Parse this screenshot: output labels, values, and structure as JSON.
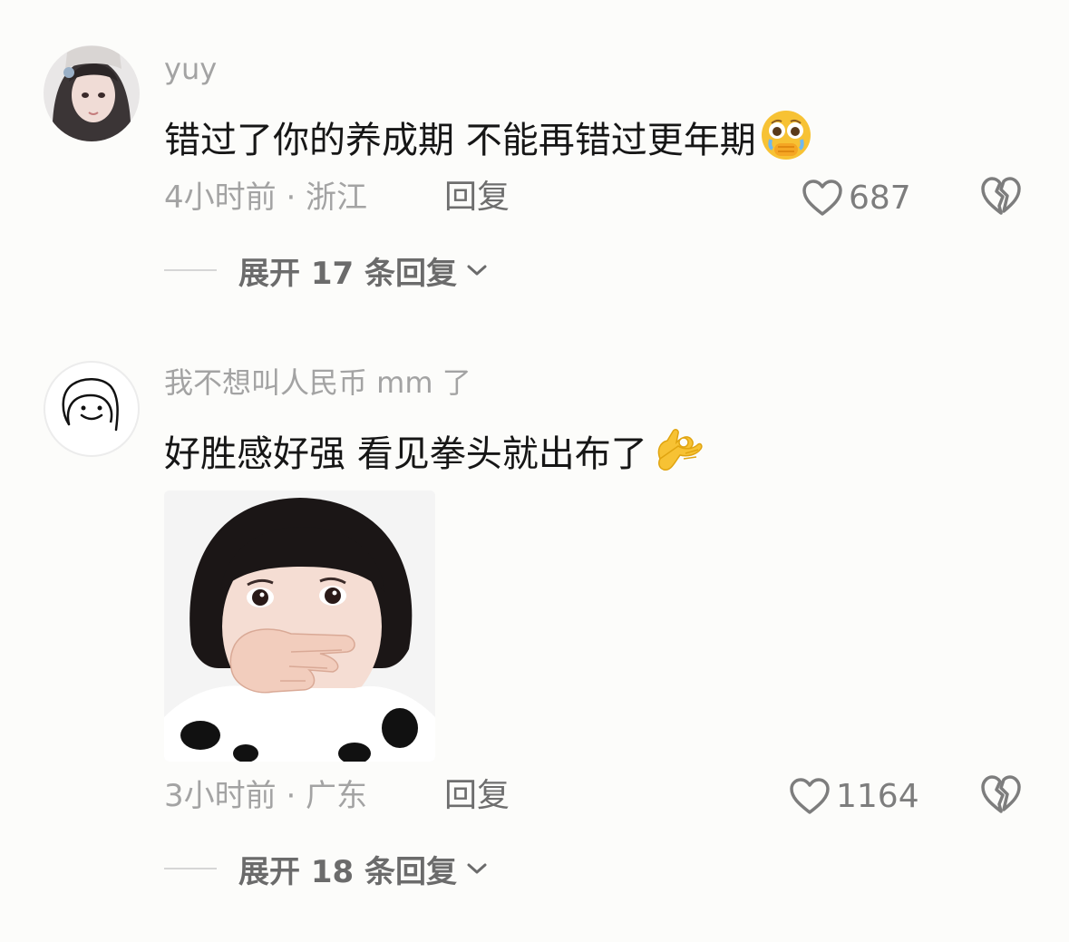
{
  "comments": [
    {
      "username": "yuy",
      "text": "错过了你的养成期 不能再错过更年期",
      "emoji": "holding-back-tears-emoji",
      "time_location": "4小时前 · 浙江",
      "reply_label": "回复",
      "likes": "687",
      "expand_label": "展开 17 条回复"
    },
    {
      "username": "我不想叫人民币 mm 了",
      "text": "好胜感好强 看见拳头就出布了",
      "emoji": "ok-hand-emoji",
      "sticker": "girl-covering-mouth-sticker",
      "time_location": "3小时前 · 广东",
      "reply_label": "回复",
      "likes": "1164",
      "expand_label": "展开 18 条回复"
    }
  ],
  "colors": {
    "background": "#fcfcfa",
    "username": "#a3a3a3",
    "text": "#161616",
    "meta": "#a3a3a3",
    "reply": "#6e6e6e",
    "expand": "#6b6b6b",
    "emoji_yellow": "#f7c234"
  }
}
